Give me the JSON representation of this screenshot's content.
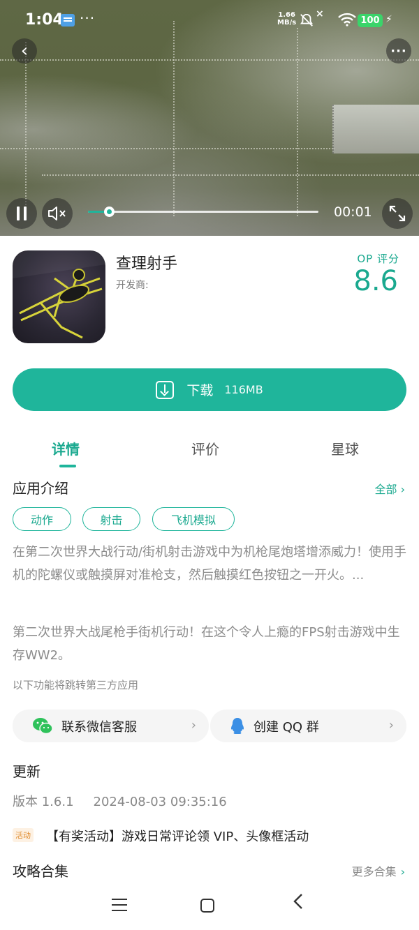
{
  "status_bar": {
    "time": "1:04",
    "dots": "···",
    "net_speed_value": "1.66",
    "net_speed_unit": "MB/s",
    "mute_x": "×",
    "battery": "100",
    "bolt": "⚡"
  },
  "video": {
    "back_icon": "‹",
    "more_icon": "···",
    "elapsed": "00:01",
    "progress": 0.09
  },
  "app": {
    "name": "查理射手",
    "developer_label": "开发商:",
    "rating_label": "OP 评分",
    "rating": "8.6"
  },
  "download": {
    "label": "下载",
    "size": "116MB"
  },
  "tabs": [
    {
      "label": "详情",
      "active": true
    },
    {
      "label": "评价",
      "active": false
    },
    {
      "label": "星球",
      "active": false
    }
  ],
  "intro": {
    "title": "应用介绍",
    "see_all": "全部 ›",
    "tags": [
      "动作",
      "射击",
      "飞机模拟"
    ],
    "desc1": "在第二次世界大战行动/街机射击游戏中为机枪尾炮塔增添威力！使用手机的陀螺仪或触摸屏对准枪支，然后触摸红色按钮之一开火。...",
    "desc2": "第二次世界大战尾枪手街机行动！在这个令人上瘾的FPS射击游戏中生存WW2。",
    "third_party_note": "以下功能将跳转第三方应用"
  },
  "services": [
    {
      "label": "联系微信客服",
      "icon": "wechat-icon"
    },
    {
      "label": "创建 QQ 群",
      "icon": "qq-icon"
    }
  ],
  "update": {
    "title": "更新",
    "version": "版本 1.6.1",
    "date": "2024-08-03 09:35:16"
  },
  "activity": {
    "badge": "活动",
    "text": "【有奖活动】游戏日常评论领 VIP、头像框活动"
  },
  "guides": {
    "title": "攻略合集",
    "more": "更多合集",
    "chevron": "›"
  },
  "colors": {
    "accent": "#1fb59b"
  }
}
